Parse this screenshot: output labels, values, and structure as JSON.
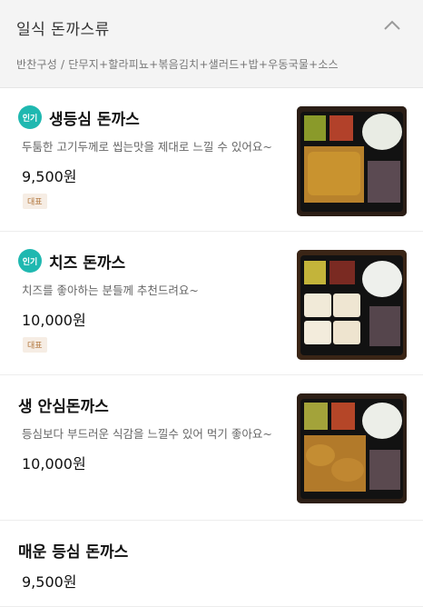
{
  "section": {
    "title": "일식 돈까스류",
    "description": "반찬구성 / 단무지+할라피뇨+볶음김치+샐러드+밥+우동국물+소스"
  },
  "items": [
    {
      "badge": "인기",
      "name": "생등심 돈까스",
      "description": "두툼한 고기두께로 씹는맛을 제대로 느낄 수 있어요~",
      "price": "9,500원",
      "tag": "대표",
      "image": "bento-fried-cutlet"
    },
    {
      "badge": "인기",
      "name": "치즈 돈까스",
      "description": "치즈를 좋아하는 분들께 추천드려요~",
      "price": "10,000원",
      "tag": "대표",
      "image": "bento-cheese-cutlet"
    },
    {
      "badge": "",
      "name": "생 안심돈까스",
      "description": "등심보다 부드러운 식감을 느낄수 있어 먹기 좋아요~",
      "price": "10,000원",
      "tag": "",
      "image": "bento-tenderloin-cutlet"
    },
    {
      "badge": "",
      "name": "매운 등심 돈까스",
      "description": "",
      "price": "9,500원",
      "tag": "",
      "image": ""
    }
  ],
  "colors": {
    "popular_badge": "#1fb8b0",
    "tag_text": "#b0743a",
    "tag_bg": "#f6ede4"
  }
}
